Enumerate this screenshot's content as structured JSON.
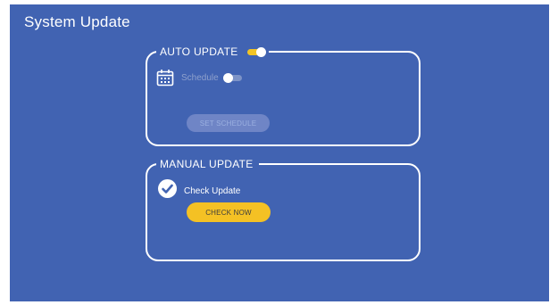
{
  "page": {
    "title": "System Update"
  },
  "auto_update": {
    "legend": "AUTO UPDATE",
    "enabled": true,
    "schedule": {
      "label": "Schedule",
      "enabled": false
    },
    "set_schedule_label": "SET SCHEDULE",
    "set_schedule_disabled": true
  },
  "manual_update": {
    "legend": "MANUAL UPDATE",
    "check_label": "Check Update",
    "checked": true,
    "check_now_label": "CHECK NOW"
  },
  "colors": {
    "background": "#4163b2",
    "accent": "#f4c124",
    "text": "#ffffff",
    "muted": "#8ea0cc"
  },
  "icons": [
    "calendar-icon",
    "checkmark-icon"
  ]
}
